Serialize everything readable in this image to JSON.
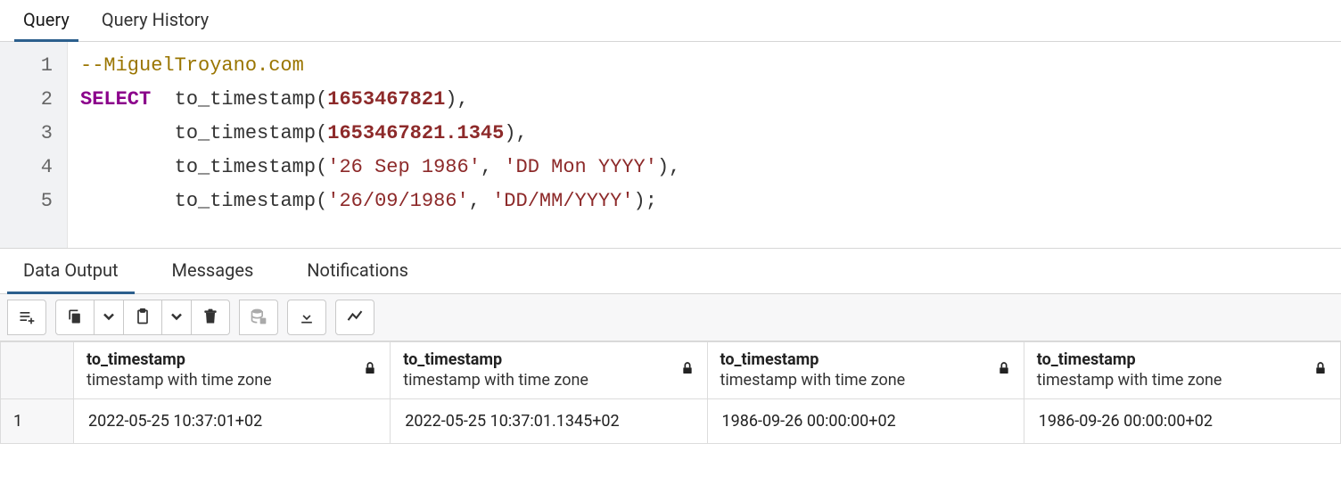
{
  "topTabs": {
    "query": "Query",
    "history": "Query History",
    "activeIndex": 0
  },
  "editor": {
    "lines": [
      "1",
      "2",
      "3",
      "4",
      "5"
    ],
    "line1_comment": "--MiguelTroyano.com",
    "line2_select": "SELECT",
    "line2_func": "to_timestamp",
    "line2_open": "(",
    "line2_num": "1653467821",
    "line2_close": "),",
    "line3_pad": "        ",
    "line3_func": "to_timestamp",
    "line3_open": "(",
    "line3_num": "1653467821.1345",
    "line3_close": "),",
    "line4_pad": "        ",
    "line4_func": "to_timestamp",
    "line4_open": "(",
    "line4_str1": "'26 Sep 1986'",
    "line4_sep": ", ",
    "line4_str2": "'DD Mon YYYY'",
    "line4_close": "),",
    "line5_pad": "        ",
    "line5_func": "to_timestamp",
    "line5_open": "(",
    "line5_str1": "'26/09/1986'",
    "line5_sep": ", ",
    "line5_str2": "'DD/MM/YYYY'",
    "line5_close": ");"
  },
  "bottomTabs": {
    "data": "Data Output",
    "messages": "Messages",
    "notifications": "Notifications",
    "activeIndex": 0
  },
  "columns": [
    {
      "name": "to_timestamp",
      "type": "timestamp with time zone"
    },
    {
      "name": "to_timestamp",
      "type": "timestamp with time zone"
    },
    {
      "name": "to_timestamp",
      "type": "timestamp with time zone"
    },
    {
      "name": "to_timestamp",
      "type": "timestamp with time zone"
    }
  ],
  "rows": [
    {
      "n": "1",
      "cells": [
        "2022-05-25 10:37:01+02",
        "2022-05-25 10:37:01.1345+02",
        "1986-09-26 00:00:00+02",
        "1986-09-26 00:00:00+02"
      ]
    }
  ]
}
